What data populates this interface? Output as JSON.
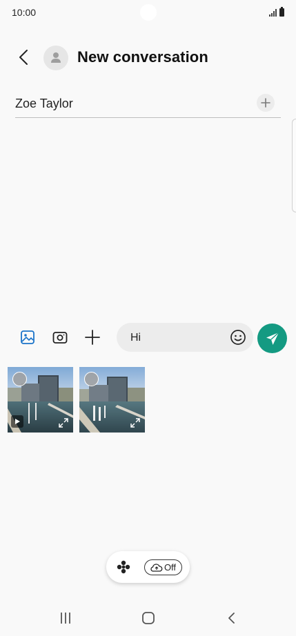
{
  "status_bar": {
    "time": "10:00",
    "icons": [
      "signal-icon",
      "battery-icon"
    ]
  },
  "header": {
    "back_icon": "chevron-left-icon",
    "avatar_icon": "person-icon",
    "title": "New conversation"
  },
  "recipient": {
    "value": "Zoe Taylor",
    "add_icon": "plus-icon"
  },
  "composer": {
    "tools": [
      "gallery-icon",
      "camera-icon",
      "plus-icon"
    ],
    "message_value": "Hi",
    "emoji_icon": "smiley-icon",
    "send_icon": "send-icon",
    "send_color": "#149a82"
  },
  "gallery": {
    "items": [
      {
        "type": "video",
        "selected": false
      },
      {
        "type": "image",
        "selected": false
      }
    ]
  },
  "bottom_pill": {
    "bixby_icon": "bixby-icon",
    "cloud_label": "Off",
    "cloud_icon": "cloud-sync-icon"
  },
  "nav": {
    "buttons": [
      "recents-icon",
      "home-icon",
      "back-icon"
    ]
  }
}
